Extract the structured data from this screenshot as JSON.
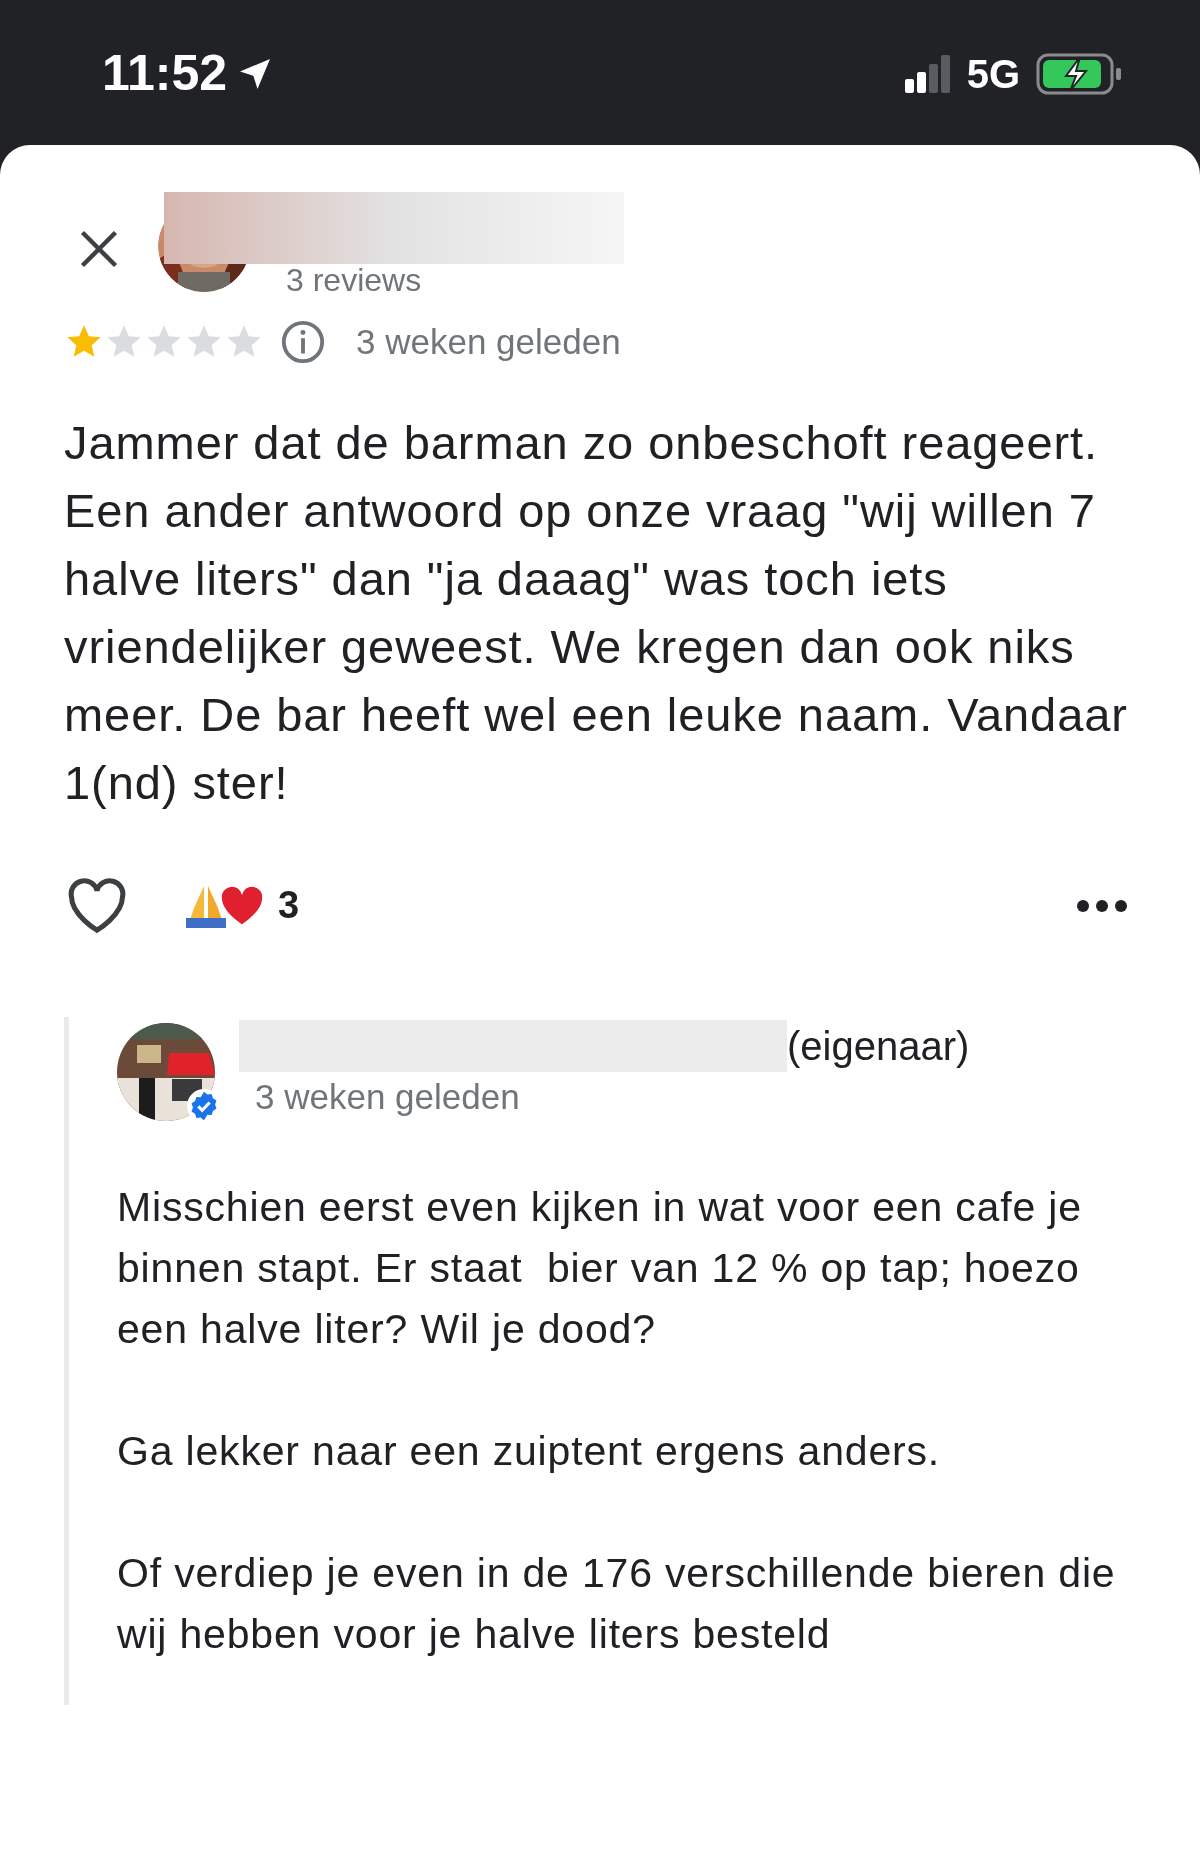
{
  "status_bar": {
    "time": "11:52",
    "network": "5G"
  },
  "reviewer": {
    "reviews_count": "3 reviews"
  },
  "review": {
    "stars": 1,
    "time": "3 weken geleden",
    "text": "Jammer dat de barman zo onbeschoft reageert. Een ander antwoord op onze vraag \"wij willen 7 halve liters\" dan \"ja daaag\" was toch iets vriendelijker geweest. We kregen dan ook niks meer. De bar heeft wel een leuke naam. Vandaar 1(nd) ster!"
  },
  "reactions": {
    "count": "3"
  },
  "reply": {
    "owner_label": "(eigenaar)",
    "time": "3 weken geleden",
    "paragraphs": [
      "Misschien eerst even kijken in wat voor een cafe je binnen stapt. Er staat  bier van 12 % op tap; hoezo een halve liter? Wil je dood?",
      "Ga lekker naar een zuiptent ergens anders.",
      "Of verdiep je even in de 176 verschillende bieren die wij hebben voor je halve liters besteld"
    ]
  }
}
